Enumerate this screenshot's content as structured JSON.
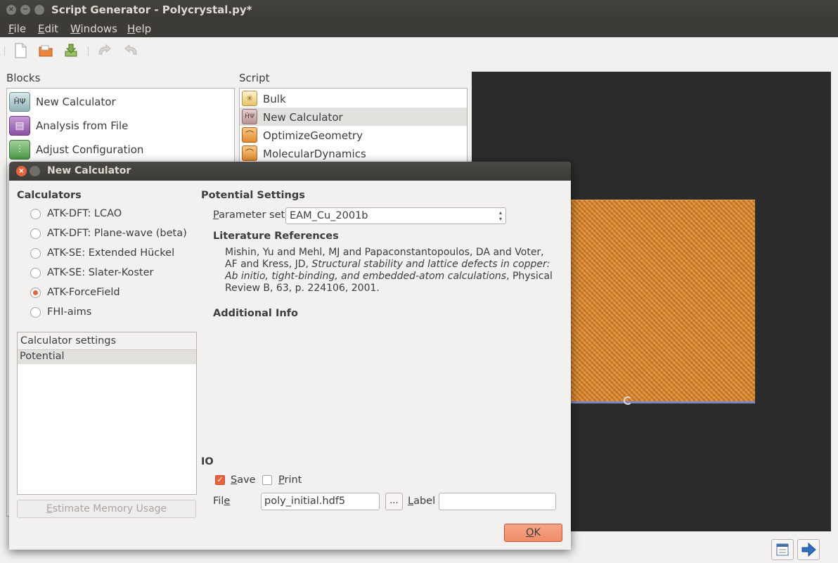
{
  "window": {
    "title": "Script Generator - Polycrystal.py*",
    "controls": [
      "×",
      "−",
      ""
    ]
  },
  "menu": [
    {
      "mnemonic": "F",
      "rest": "ile"
    },
    {
      "mnemonic": "E",
      "rest": "dit"
    },
    {
      "mnemonic": "W",
      "rest": "indows"
    },
    {
      "mnemonic": "H",
      "rest": "elp"
    }
  ],
  "toolbar": {
    "icons": [
      "new-document-icon",
      "open-folder-icon",
      "save-download-icon",
      "undo-icon",
      "redo-icon"
    ]
  },
  "blocks": {
    "label": "Blocks",
    "items": [
      {
        "label": "New Calculator",
        "icon": "calculator-icon",
        "glyph": "ĤΨ"
      },
      {
        "label": "Analysis from File",
        "icon": "analysis-file-icon",
        "glyph": "▤"
      },
      {
        "label": "Adjust Configuration",
        "icon": "adjust-configuration-icon",
        "glyph": "⫶"
      }
    ]
  },
  "script": {
    "label": "Script",
    "items": [
      {
        "label": "Bulk",
        "icon": "bulk-icon",
        "glyph": "✳"
      },
      {
        "label": "New Calculator",
        "icon": "calculator-icon",
        "glyph": "ĤΨ"
      },
      {
        "label": "OptimizeGeometry",
        "icon": "optimize-geometry-icon",
        "glyph": "⌒"
      },
      {
        "label": "MolecularDynamics",
        "icon": "molecular-dynamics-icon",
        "glyph": "⌒"
      }
    ]
  },
  "dialog": {
    "title": "New Calculator",
    "calculators_label": "Calculators",
    "calculators": [
      {
        "label": "ATK-DFT: LCAO",
        "selected": false
      },
      {
        "label": "ATK-DFT: Plane-wave (beta)",
        "selected": false
      },
      {
        "label": "ATK-SE: Extended Hückel",
        "selected": false
      },
      {
        "label": "ATK-SE: Slater-Koster",
        "selected": false
      },
      {
        "label": "ATK-ForceField",
        "selected": true
      },
      {
        "label": "FHI-aims",
        "selected": false
      }
    ],
    "settings_header": "Calculator settings",
    "settings_items": [
      "Potential"
    ],
    "estimate_button": "Estimate Memory Usage",
    "potential_settings_label": "Potential Settings",
    "parameter_set_label": "Parameter set",
    "parameter_set_value": "EAM_Cu_2001b",
    "literature_label": "Literature References",
    "literature": {
      "authors": "Mishin, Yu and Mehl, MJ and Papaconstantopoulos, DA and Voter, AF and Kress, JD, ",
      "title": "Structural stability and lattice defects in copper: Ab initio, tight-binding, and embedded-atom calculations",
      "tail": ", Physical Review B, 63, p. 224106, 2001."
    },
    "additional_info_label": "Additional Info",
    "io_label": "IO",
    "save_label": "Save",
    "save_checked": true,
    "print_label": "Print",
    "print_checked": false,
    "file_label": "File",
    "file_value": "poly_initial.hdf5",
    "browse_label": "...",
    "label_label": "Label",
    "label_value": "",
    "ok_label": "OK"
  },
  "colors": {
    "accent": "#e4643f",
    "crystal": "#dd8a34",
    "viewer_bg": "#2b2b2b"
  }
}
